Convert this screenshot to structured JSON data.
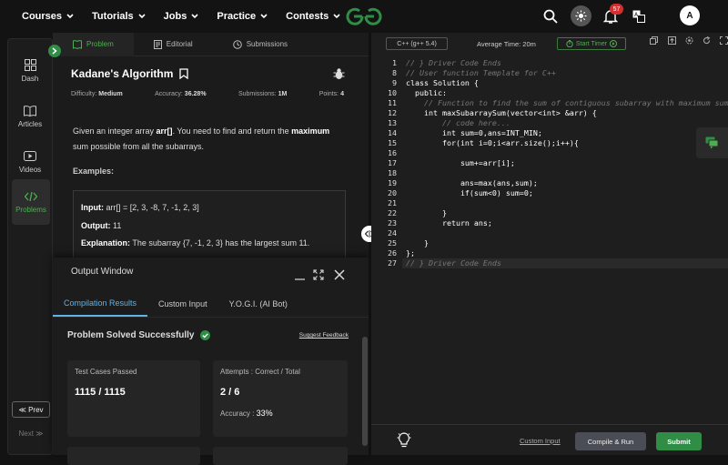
{
  "topnav": {
    "items": [
      "Courses",
      "Tutorials",
      "Jobs",
      "Practice",
      "Contests"
    ],
    "notification_count": "57",
    "avatar_letter": "A"
  },
  "sidebar": {
    "items": [
      {
        "label": "Dash",
        "icon": "dashboard-icon"
      },
      {
        "label": "Articles",
        "icon": "book-icon"
      },
      {
        "label": "Videos",
        "icon": "video-icon"
      },
      {
        "label": "Problems",
        "icon": "code-icon"
      }
    ],
    "prev_label": "≪ Prev",
    "next_label": "Next ≫"
  },
  "problem_tabs": [
    "Problem",
    "Editorial",
    "Submissions"
  ],
  "problem": {
    "title": "Kadane's Algorithm",
    "difficulty_label": "Difficulty:",
    "difficulty": "Medium",
    "accuracy_label": "Accuracy:",
    "accuracy": "36.28%",
    "submissions_label": "Submissions:",
    "submissions": "1M",
    "points_label": "Points:",
    "points": "4",
    "desc_1": "Given an integer array ",
    "desc_arr": "arr[]",
    "desc_2": ". You need to find and return the ",
    "desc_max": "maximum",
    "desc_3": " sum possible from all the subarrays.",
    "examples_label": "Examples:",
    "input_label": "Input:",
    "input_value": "arr[] = [2, 3, -8, 7, -1, 2, 3]",
    "output_label": "Output:",
    "output_value": "11",
    "explanation_label": "Explanation:",
    "explanation_value": "The subarray {7, -1, 2, 3} has the largest sum 11."
  },
  "output_window": {
    "title": "Output Window",
    "tabs": [
      "Compilation Results",
      "Custom Input",
      "Y.O.G.I. (AI Bot)"
    ],
    "status": "Problem Solved Successfully",
    "suggest_feedback": "Suggest Feedback",
    "test_cases_label": "Test Cases Passed",
    "test_cases_value": "1115 / 1115",
    "attempts_label": "Attempts : Correct / Total",
    "attempts_value": "2 / 6",
    "accuracy_label": "Accuracy :",
    "accuracy_value": "33%"
  },
  "editor": {
    "language": "C++ (g++ 5.4)",
    "average_time": "Average Time: 20m",
    "start_timer": "Start Timer",
    "lines": [
      {
        "n": "1",
        "text": "// } Driver Code Ends"
      },
      {
        "n": "8",
        "text": "// User function Template for C++"
      },
      {
        "n": "9",
        "text": "class Solution {"
      },
      {
        "n": "10",
        "text": "  public:"
      },
      {
        "n": "11",
        "text": "    // Function to find the sum of contiguous subarray with maximum sum."
      },
      {
        "n": "12",
        "text": "    int maxSubarraySum(vector<int> &arr) {"
      },
      {
        "n": "13",
        "text": "        // code here..."
      },
      {
        "n": "14",
        "text": "        int sum=0,ans=INT_MIN;"
      },
      {
        "n": "15",
        "text": "        for(int i=0;i<arr.size();i++){"
      },
      {
        "n": "16",
        "text": ""
      },
      {
        "n": "17",
        "text": "            sum+=arr[i];"
      },
      {
        "n": "18",
        "text": ""
      },
      {
        "n": "19",
        "text": "            ans=max(ans,sum);"
      },
      {
        "n": "20",
        "text": "            if(sum<0) sum=0;"
      },
      {
        "n": "21",
        "text": ""
      },
      {
        "n": "22",
        "text": "        }"
      },
      {
        "n": "23",
        "text": "        return ans;"
      },
      {
        "n": "24",
        "text": ""
      },
      {
        "n": "25",
        "text": "    }"
      },
      {
        "n": "26",
        "text": "};"
      },
      {
        "n": "27",
        "text": "// } Driver Code Ends"
      }
    ],
    "custom_input": "Custom Input",
    "compile_run": "Compile & Run",
    "submit": "Submit"
  },
  "colors": {
    "accent_green": "#2f8d46",
    "tab_blue": "#5fb3e6",
    "background": "#131313"
  }
}
